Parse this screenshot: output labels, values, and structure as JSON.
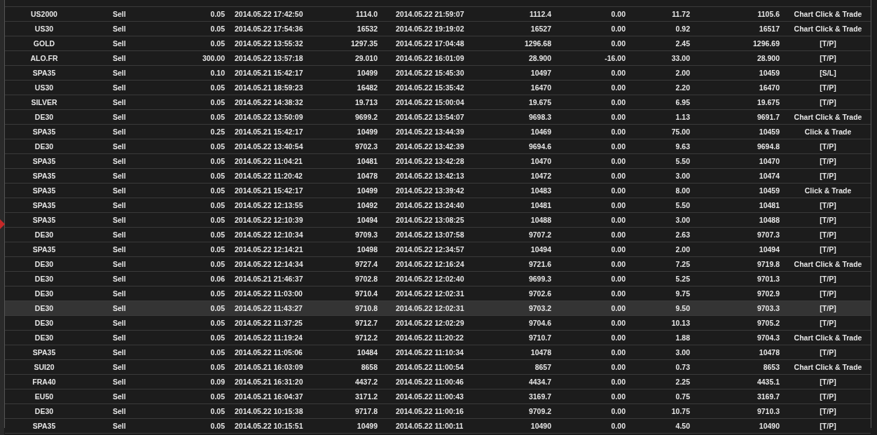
{
  "table": {
    "rows": [
      {
        "selected": false,
        "cells": [
          "US2000",
          "Sell",
          "0.05",
          "2014.05.22 17:42:50",
          "1114.0",
          "2014.05.22 21:59:07",
          "1112.4",
          "0.00",
          "11.72",
          "1105.6",
          "Chart Click & Trade"
        ]
      },
      {
        "selected": false,
        "cells": [
          "US30",
          "Sell",
          "0.05",
          "2014.05.22 17:54:36",
          "16532",
          "2014.05.22 19:19:02",
          "16527",
          "0.00",
          "0.92",
          "16517",
          "Chart Click & Trade"
        ]
      },
      {
        "selected": false,
        "cells": [
          "GOLD",
          "Sell",
          "0.05",
          "2014.05.22 13:55:32",
          "1297.35",
          "2014.05.22 17:04:48",
          "1296.68",
          "0.00",
          "2.45",
          "1296.69",
          "[T/P]"
        ]
      },
      {
        "selected": false,
        "cells": [
          "ALO.FR",
          "Sell",
          "300.00",
          "2014.05.22 13:57:18",
          "29.010",
          "2014.05.22 16:01:09",
          "28.900",
          "-16.00",
          "33.00",
          "28.900",
          "[T/P]"
        ]
      },
      {
        "selected": false,
        "cells": [
          "SPA35",
          "Sell",
          "0.10",
          "2014.05.21 15:42:17",
          "10499",
          "2014.05.22 15:45:30",
          "10497",
          "0.00",
          "2.00",
          "10459",
          "[S/L]"
        ]
      },
      {
        "selected": false,
        "cells": [
          "US30",
          "Sell",
          "0.05",
          "2014.05.21 18:59:23",
          "16482",
          "2014.05.22 15:35:42",
          "16470",
          "0.00",
          "2.20",
          "16470",
          "[T/P]"
        ]
      },
      {
        "selected": false,
        "cells": [
          "SILVER",
          "Sell",
          "0.05",
          "2014.05.22 14:38:32",
          "19.713",
          "2014.05.22 15:00:04",
          "19.675",
          "0.00",
          "6.95",
          "19.675",
          "[T/P]"
        ]
      },
      {
        "selected": false,
        "cells": [
          "DE30",
          "Sell",
          "0.05",
          "2014.05.22 13:50:09",
          "9699.2",
          "2014.05.22 13:54:07",
          "9698.3",
          "0.00",
          "1.13",
          "9691.7",
          "Chart Click & Trade"
        ]
      },
      {
        "selected": false,
        "cells": [
          "SPA35",
          "Sell",
          "0.25",
          "2014.05.21 15:42:17",
          "10499",
          "2014.05.22 13:44:39",
          "10469",
          "0.00",
          "75.00",
          "10459",
          "Click & Trade"
        ]
      },
      {
        "selected": false,
        "cells": [
          "DE30",
          "Sell",
          "0.05",
          "2014.05.22 13:40:54",
          "9702.3",
          "2014.05.22 13:42:39",
          "9694.6",
          "0.00",
          "9.63",
          "9694.8",
          "[T/P]"
        ]
      },
      {
        "selected": false,
        "cells": [
          "SPA35",
          "Sell",
          "0.05",
          "2014.05.22 11:04:21",
          "10481",
          "2014.05.22 13:42:28",
          "10470",
          "0.00",
          "5.50",
          "10470",
          "[T/P]"
        ]
      },
      {
        "selected": false,
        "cells": [
          "SPA35",
          "Sell",
          "0.05",
          "2014.05.22 11:20:42",
          "10478",
          "2014.05.22 13:42:13",
          "10472",
          "0.00",
          "3.00",
          "10474",
          "[T/P]"
        ]
      },
      {
        "selected": false,
        "cells": [
          "SPA35",
          "Sell",
          "0.05",
          "2014.05.21 15:42:17",
          "10499",
          "2014.05.22 13:39:42",
          "10483",
          "0.00",
          "8.00",
          "10459",
          "Click & Trade"
        ]
      },
      {
        "selected": false,
        "cells": [
          "SPA35",
          "Sell",
          "0.05",
          "2014.05.22 12:13:55",
          "10492",
          "2014.05.22 13:24:40",
          "10481",
          "0.00",
          "5.50",
          "10481",
          "[T/P]"
        ]
      },
      {
        "selected": false,
        "cells": [
          "SPA35",
          "Sell",
          "0.05",
          "2014.05.22 12:10:39",
          "10494",
          "2014.05.22 13:08:25",
          "10488",
          "0.00",
          "3.00",
          "10488",
          "[T/P]"
        ]
      },
      {
        "selected": false,
        "cells": [
          "DE30",
          "Sell",
          "0.05",
          "2014.05.22 12:10:34",
          "9709.3",
          "2014.05.22 13:07:58",
          "9707.2",
          "0.00",
          "2.63",
          "9707.3",
          "[T/P]"
        ]
      },
      {
        "selected": false,
        "cells": [
          "SPA35",
          "Sell",
          "0.05",
          "2014.05.22 12:14:21",
          "10498",
          "2014.05.22 12:34:57",
          "10494",
          "0.00",
          "2.00",
          "10494",
          "[T/P]"
        ]
      },
      {
        "selected": false,
        "cells": [
          "DE30",
          "Sell",
          "0.05",
          "2014.05.22 12:14:34",
          "9727.4",
          "2014.05.22 12:16:24",
          "9721.6",
          "0.00",
          "7.25",
          "9719.8",
          "Chart Click & Trade"
        ]
      },
      {
        "selected": false,
        "cells": [
          "DE30",
          "Sell",
          "0.06",
          "2014.05.21 21:46:37",
          "9702.8",
          "2014.05.22 12:02:40",
          "9699.3",
          "0.00",
          "5.25",
          "9701.3",
          "[T/P]"
        ]
      },
      {
        "selected": false,
        "cells": [
          "DE30",
          "Sell",
          "0.05",
          "2014.05.22 11:03:00",
          "9710.4",
          "2014.05.22 12:02:31",
          "9702.6",
          "0.00",
          "9.75",
          "9702.9",
          "[T/P]"
        ]
      },
      {
        "selected": true,
        "cells": [
          "DE30",
          "Sell",
          "0.05",
          "2014.05.22 11:43:27",
          "9710.8",
          "2014.05.22 12:02:31",
          "9703.2",
          "0.00",
          "9.50",
          "9703.3",
          "[T/P]"
        ]
      },
      {
        "selected": false,
        "cells": [
          "DE30",
          "Sell",
          "0.05",
          "2014.05.22 11:37:25",
          "9712.7",
          "2014.05.22 12:02:29",
          "9704.6",
          "0.00",
          "10.13",
          "9705.2",
          "[T/P]"
        ]
      },
      {
        "selected": false,
        "cells": [
          "DE30",
          "Sell",
          "0.05",
          "2014.05.22 11:19:24",
          "9712.2",
          "2014.05.22 11:20:22",
          "9710.7",
          "0.00",
          "1.88",
          "9704.3",
          "Chart Click & Trade"
        ]
      },
      {
        "selected": false,
        "cells": [
          "SPA35",
          "Sell",
          "0.05",
          "2014.05.22 11:05:06",
          "10484",
          "2014.05.22 11:10:34",
          "10478",
          "0.00",
          "3.00",
          "10478",
          "[T/P]"
        ]
      },
      {
        "selected": false,
        "cells": [
          "SUI20",
          "Sell",
          "0.05",
          "2014.05.21 16:03:09",
          "8658",
          "2014.05.22 11:00:54",
          "8657",
          "0.00",
          "0.73",
          "8653",
          "Chart Click & Trade"
        ]
      },
      {
        "selected": false,
        "cells": [
          "FRA40",
          "Sell",
          "0.09",
          "2014.05.21 16:31:20",
          "4437.2",
          "2014.05.22 11:00:46",
          "4434.7",
          "0.00",
          "2.25",
          "4435.1",
          "[T/P]"
        ]
      },
      {
        "selected": false,
        "cells": [
          "EU50",
          "Sell",
          "0.05",
          "2014.05.21 16:04:37",
          "3171.2",
          "2014.05.22 11:00:43",
          "3169.7",
          "0.00",
          "0.75",
          "3169.7",
          "[T/P]"
        ]
      },
      {
        "selected": false,
        "cells": [
          "DE30",
          "Sell",
          "0.05",
          "2014.05.22 10:15:38",
          "9717.8",
          "2014.05.22 11:00:16",
          "9709.2",
          "0.00",
          "10.75",
          "9710.3",
          "[T/P]"
        ]
      },
      {
        "selected": false,
        "cells": [
          "SPA35",
          "Sell",
          "0.05",
          "2014.05.22 10:15:51",
          "10499",
          "2014.05.22 11:00:11",
          "10490",
          "0.00",
          "4.50",
          "10490",
          "[T/P]"
        ]
      }
    ]
  }
}
